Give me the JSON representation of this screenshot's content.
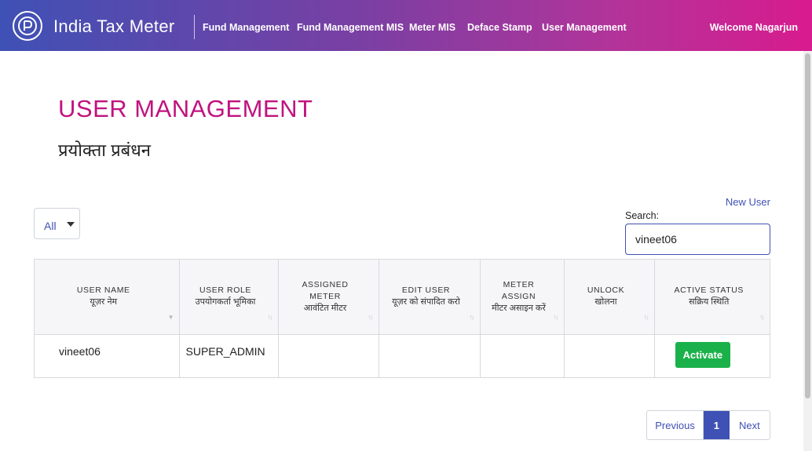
{
  "header": {
    "app_title": "India Tax Meter",
    "nav": [
      "Fund Management",
      "Fund Management MIS",
      "Meter MIS",
      "Deface Stamp",
      "User Management"
    ],
    "welcome": "Welcome Nagarjun",
    "logo_icon": "rupee-circle-icon"
  },
  "page": {
    "title": "USER MANAGEMENT",
    "subtitle": "प्रयोक्ता प्रबंधन"
  },
  "controls": {
    "new_user_label": "New User",
    "filter_value": "All",
    "search_label": "Search:",
    "search_value": "vineet06"
  },
  "table": {
    "columns": [
      {
        "en": "USER NAME",
        "hi": "यूज़र नेम"
      },
      {
        "en": "USER ROLE",
        "hi": "उपयोगकर्ता भूमिका"
      },
      {
        "en": "ASSIGNED METER",
        "hi": "आवंटित मीटर"
      },
      {
        "en": "EDIT USER",
        "hi": "यूज़र को संपादित करो"
      },
      {
        "en": "METER ASSIGN",
        "hi": "मीटर असाइन करें"
      },
      {
        "en": "UNLOCK",
        "hi": "खोलना"
      },
      {
        "en": "ACTIVE STATUS",
        "hi": "सक्रिय स्थिति"
      }
    ],
    "rows": [
      {
        "user_name": "vineet06",
        "user_role": "SUPER_ADMIN",
        "assigned_meter": "",
        "action": "Activate"
      }
    ]
  },
  "pagination": {
    "previous": "Previous",
    "current": "1",
    "next": "Next"
  },
  "colors": {
    "accent": "#3f51b5",
    "title": "#c0137f",
    "activate": "#1bb14a"
  }
}
